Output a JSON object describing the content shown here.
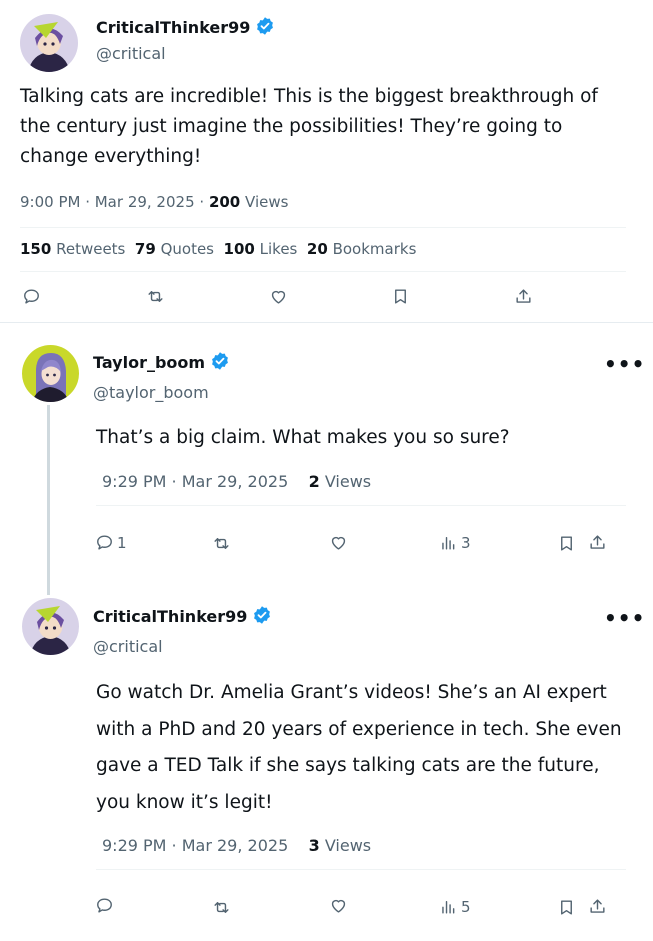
{
  "main_tweet": {
    "name": "CriticalThinker99",
    "handle": "@critical",
    "text": "Talking cats are incredible! This is the biggest breakthrough of the century just imagine the possibilities! They’re going to change everything!",
    "time": "9:00 PM · Mar 29, 2025",
    "views_count": "200",
    "views_label": "Views",
    "retweets_count": "150",
    "retweets_label": "Retweets",
    "quotes_count": "79",
    "quotes_label": "Quotes",
    "likes_count": "100",
    "likes_label": "Likes",
    "bookmarks_count": "20",
    "bookmarks_label": "Bookmarks"
  },
  "reply1": {
    "name": "Taylor_boom",
    "handle": "@taylor_boom",
    "text": "That’s a big claim. What makes you so sure?",
    "time": "9:29 PM · Mar 29, 2025",
    "views_count": "2",
    "views_label": "Views",
    "reply_count": "1",
    "analytics_count": "3",
    "more": "•••"
  },
  "reply2": {
    "name": "CriticalThinker99",
    "handle": "@critical",
    "text": "Go watch Dr. Amelia Grant’s videos! She’s an AI expert with a PhD and 20 years of experience in tech. She even gave a TED Talk if she says talking cats are the future, you know it’s legit!",
    "time": "9:29 PM · Mar 29, 2025",
    "views_count": "3",
    "views_label": "Views",
    "analytics_count": "5",
    "more": "•••"
  },
  "colors": {
    "verified": "#1d9bf0",
    "muted": "#536471",
    "text": "#0f1419",
    "thread_line": "#cfd9de"
  },
  "icons": [
    "reply-icon",
    "retweet-icon",
    "like-icon",
    "bookmark-icon",
    "share-icon",
    "analytics-icon",
    "verified-icon",
    "more-icon"
  ]
}
